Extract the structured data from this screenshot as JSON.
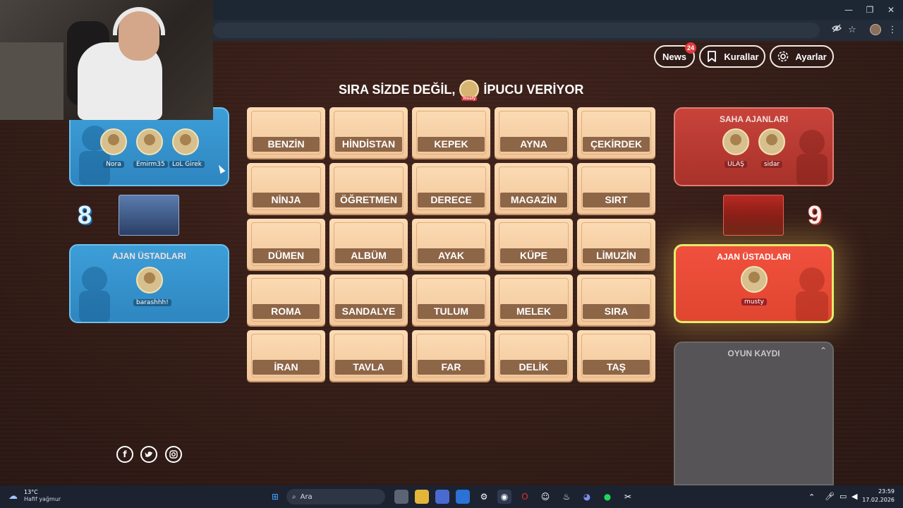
{
  "browser": {
    "window_controls": [
      "—",
      "❐",
      "✕"
    ],
    "toolbar_icons": [
      "eye-off-icon",
      "star-icon",
      "more-icon"
    ]
  },
  "header": {
    "news_label": "News",
    "news_count": "24",
    "rules_label": "Kurallar",
    "settings_label": "Ayarlar"
  },
  "turn": {
    "prefix": "SIRA SİZDE DEĞİL,",
    "avatar_name": "musty",
    "suffix": "İPUCU VERİYOR"
  },
  "cards": [
    "BENZİN",
    "HİNDİSTAN",
    "KEPEK",
    "AYNA",
    "ÇEKİRDEK",
    "NİNJA",
    "ÖĞRETMEN",
    "DERECE",
    "MAGAZİN",
    "SIRT",
    "DÜMEN",
    "ALBÜM",
    "AYAK",
    "KÜPE",
    "LİMUZİN",
    "ROMA",
    "SANDALYE",
    "TULUM",
    "MELEK",
    "SIRA",
    "İRAN",
    "TAVLA",
    "FAR",
    "DELİK",
    "TAŞ"
  ],
  "blue_team": {
    "operatives": [
      "Nora",
      "Emirm35",
      "LoL Girek"
    ],
    "score": "8",
    "spymaster_title": "AJAN ÜSTADLARI",
    "spymasters": [
      "barashhh!"
    ]
  },
  "red_team": {
    "operatives_title": "SAHA AJANLARI",
    "operatives": [
      "ULAŞ",
      "sidar"
    ],
    "score": "9",
    "spymaster_title": "AJAN ÜSTADLARI",
    "spymasters": [
      "musty"
    ]
  },
  "game_log": {
    "title": "OYUN KAYDI"
  },
  "taskbar": {
    "weather_temp": "13°C",
    "weather_desc": "Hafif yağmur",
    "search_placeholder": "Ara",
    "time": "23:59",
    "date": "17.02.2026"
  }
}
